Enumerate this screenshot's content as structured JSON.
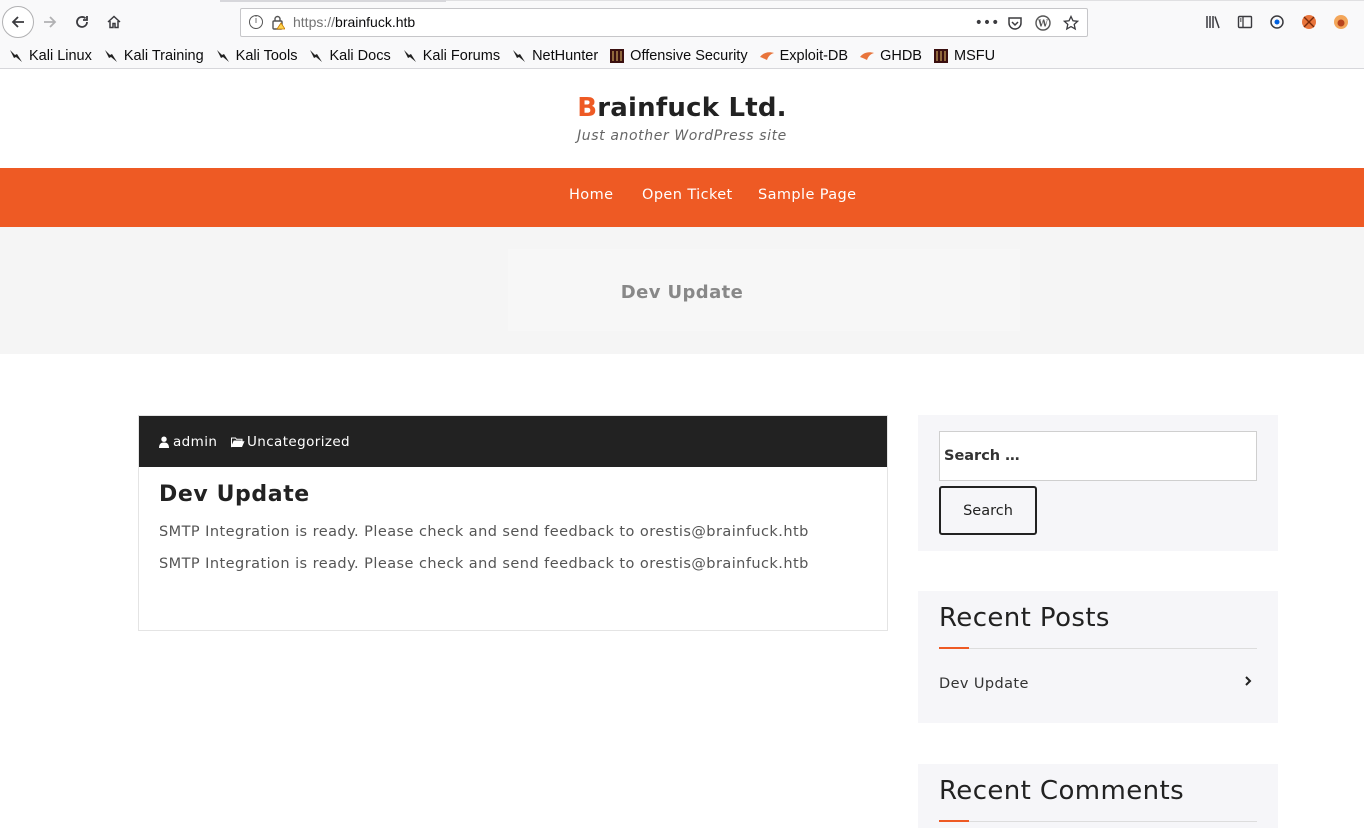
{
  "browser": {
    "url_scheme": "https://",
    "url_host": "brainfuck.htb",
    "bookmarks": [
      {
        "label": "Kali Linux",
        "icon": "kali-dragon-icon"
      },
      {
        "label": "Kali Training",
        "icon": "kali-dragon-icon"
      },
      {
        "label": "Kali Tools",
        "icon": "kali-dragon-icon"
      },
      {
        "label": "Kali Docs",
        "icon": "kali-dragon-icon"
      },
      {
        "label": "Kali Forums",
        "icon": "kali-dragon-icon"
      },
      {
        "label": "NetHunter",
        "icon": "kali-dragon-icon"
      },
      {
        "label": "Offensive Security",
        "icon": "offsec-icon"
      },
      {
        "label": "Exploit-DB",
        "icon": "exploitdb-icon"
      },
      {
        "label": "GHDB",
        "icon": "exploitdb-icon"
      },
      {
        "label": "MSFU",
        "icon": "offsec-icon"
      }
    ]
  },
  "site": {
    "title_first": "B",
    "title_rest": "rainfuck Ltd.",
    "tagline": "Just another WordPress site",
    "accent": "#ee5a24"
  },
  "nav": {
    "items": [
      "Home",
      "Open Ticket",
      "Sample Page"
    ]
  },
  "banner": {
    "title": "Dev Update"
  },
  "post": {
    "author": "admin",
    "category": "Uncategorized",
    "title": "Dev Update",
    "paragraphs": [
      "SMTP Integration is ready. Please check and send feedback to orestis@brainfuck.htb",
      "SMTP Integration is ready. Please check and send feedback to orestis@brainfuck.htb"
    ]
  },
  "sidebar": {
    "search_placeholder": "Search …",
    "search_button": "Search",
    "recent_posts_title": "Recent Posts",
    "recent_posts": [
      "Dev Update"
    ],
    "recent_comments_title": "Recent Comments"
  }
}
